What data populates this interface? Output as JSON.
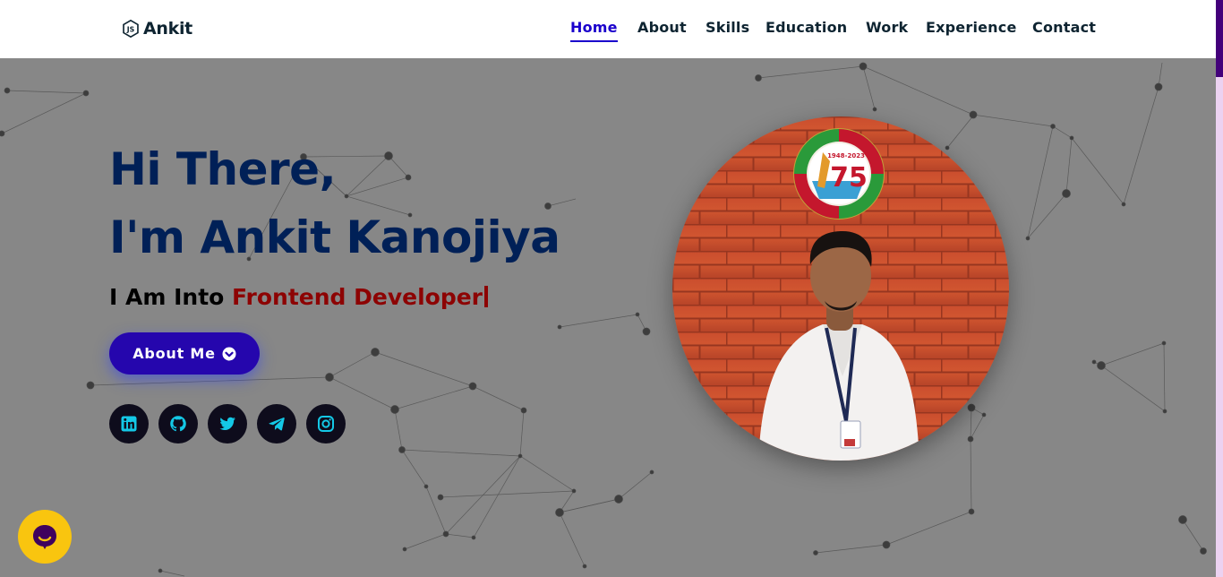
{
  "header": {
    "logo_text": "Ankit",
    "logo_icon": "js-icon",
    "nav": [
      {
        "label": "Home",
        "active": true
      },
      {
        "label": "About",
        "active": false
      },
      {
        "label": "Skills",
        "active": false
      },
      {
        "label": "Education",
        "active": false
      },
      {
        "label": "Work",
        "active": false
      },
      {
        "label": "Experience",
        "active": false
      },
      {
        "label": "Contact",
        "active": false
      }
    ]
  },
  "hero": {
    "greeting": "Hi There,",
    "name_line": "I'm Ankit Kanojiya",
    "subtitle_prefix": "I Am Into ",
    "subtitle_typed": "Frontend Developer",
    "button_label": "About Me",
    "button_icon": "chevron-circle-down-icon",
    "socials": [
      "linkedin-icon",
      "github-icon",
      "twitter-icon",
      "telegram-icon",
      "instagram-icon"
    ],
    "portrait_badge": {
      "years": "1948-2023",
      "number": "75"
    }
  },
  "chat_widget": {
    "icon": "chat-icon"
  },
  "colors": {
    "header_bg": "#ffffff",
    "hero_bg": "#878787",
    "heading": "#002057",
    "typed": "#8d0303",
    "button": "#2506ad",
    "nav_active": "#1a00cc",
    "social_bg": "#0e0c1c",
    "social_icon": "#14c8e6",
    "chat_bg": "#f9c50f",
    "chat_icon": "#40025e"
  }
}
